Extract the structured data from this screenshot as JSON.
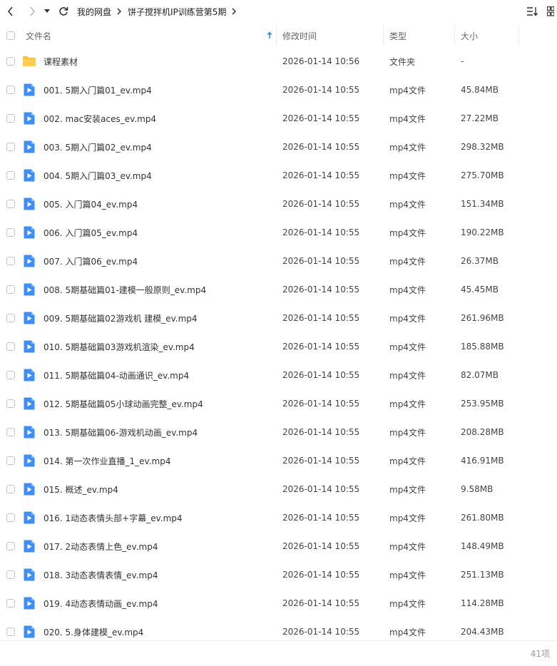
{
  "breadcrumb": [
    "我的网盘",
    "饼子搅拌机IP训练营第5期"
  ],
  "columns": {
    "name": "文件名",
    "time": "修改时间",
    "type": "类型",
    "size": "大小"
  },
  "colors": {
    "folder": "#f9c234",
    "video": "#3d8ef7",
    "accent": "#3d8ef7"
  },
  "files": [
    {
      "name": "课程素材",
      "time": "2026-01-14 10:56",
      "type": "文件夹",
      "size": "-",
      "icon": "folder-icon"
    },
    {
      "name": "001. 5期入门篇01_ev.mp4",
      "time": "2026-01-14 10:55",
      "type": "mp4文件",
      "size": "45.84MB",
      "icon": "video-file-icon"
    },
    {
      "name": "002. mac安装aces_ev.mp4",
      "time": "2026-01-14 10:55",
      "type": "mp4文件",
      "size": "27.22MB",
      "icon": "video-file-icon"
    },
    {
      "name": "003. 5期入门篇02_ev.mp4",
      "time": "2026-01-14 10:55",
      "type": "mp4文件",
      "size": "298.32MB",
      "icon": "video-file-icon"
    },
    {
      "name": "004. 5期入门篇03_ev.mp4",
      "time": "2026-01-14 10:55",
      "type": "mp4文件",
      "size": "275.70MB",
      "icon": "video-file-icon"
    },
    {
      "name": "005. 入门篇04_ev.mp4",
      "time": "2026-01-14 10:55",
      "type": "mp4文件",
      "size": "151.34MB",
      "icon": "video-file-icon"
    },
    {
      "name": "006. 入门篇05_ev.mp4",
      "time": "2026-01-14 10:55",
      "type": "mp4文件",
      "size": "190.22MB",
      "icon": "video-file-icon"
    },
    {
      "name": "007. 入门篇06_ev.mp4",
      "time": "2026-01-14 10:55",
      "type": "mp4文件",
      "size": "26.37MB",
      "icon": "video-file-icon"
    },
    {
      "name": "008. 5期基础篇01-建模一般原则_ev.mp4",
      "time": "2026-01-14 10:55",
      "type": "mp4文件",
      "size": "45.45MB",
      "icon": "video-file-icon"
    },
    {
      "name": "009. 5期基础篇02游戏机 建模_ev.mp4",
      "time": "2026-01-14 10:55",
      "type": "mp4文件",
      "size": "261.96MB",
      "icon": "video-file-icon"
    },
    {
      "name": "010. 5期基础篇03游戏机渲染_ev.mp4",
      "time": "2026-01-14 10:55",
      "type": "mp4文件",
      "size": "185.88MB",
      "icon": "video-file-icon"
    },
    {
      "name": "011. 5期基础篇04-动画通识_ev.mp4",
      "time": "2026-01-14 10:55",
      "type": "mp4文件",
      "size": "82.07MB",
      "icon": "video-file-icon"
    },
    {
      "name": "012. 5期基础篇05小球动画完整_ev.mp4",
      "time": "2026-01-14 10:55",
      "type": "mp4文件",
      "size": "253.95MB",
      "icon": "video-file-icon"
    },
    {
      "name": "013. 5期基础篇06-游戏机动画_ev.mp4",
      "time": "2026-01-14 10:55",
      "type": "mp4文件",
      "size": "208.28MB",
      "icon": "video-file-icon"
    },
    {
      "name": "014. 第一次作业直播_1_ev.mp4",
      "time": "2026-01-14 10:55",
      "type": "mp4文件",
      "size": "416.91MB",
      "icon": "video-file-icon"
    },
    {
      "name": "015. 概述_ev.mp4",
      "time": "2026-01-14 10:55",
      "type": "mp4文件",
      "size": "9.58MB",
      "icon": "video-file-icon"
    },
    {
      "name": "016. 1动态表情头部+字幕_ev.mp4",
      "time": "2026-01-14 10:55",
      "type": "mp4文件",
      "size": "261.80MB",
      "icon": "video-file-icon"
    },
    {
      "name": "017. 2动态表情上色_ev.mp4",
      "time": "2026-01-14 10:55",
      "type": "mp4文件",
      "size": "148.49MB",
      "icon": "video-file-icon"
    },
    {
      "name": "018. 3动态表情表情_ev.mp4",
      "time": "2026-01-14 10:55",
      "type": "mp4文件",
      "size": "251.13MB",
      "icon": "video-file-icon"
    },
    {
      "name": "019. 4动态表情动画_ev.mp4",
      "time": "2026-01-14 10:55",
      "type": "mp4文件",
      "size": "114.28MB",
      "icon": "video-file-icon"
    },
    {
      "name": "020. 5.身体建模_ev.mp4",
      "time": "2026-01-14 10:55",
      "type": "mp4文件",
      "size": "204.43MB",
      "icon": "video-file-icon"
    }
  ],
  "footer": {
    "count": "41项"
  }
}
